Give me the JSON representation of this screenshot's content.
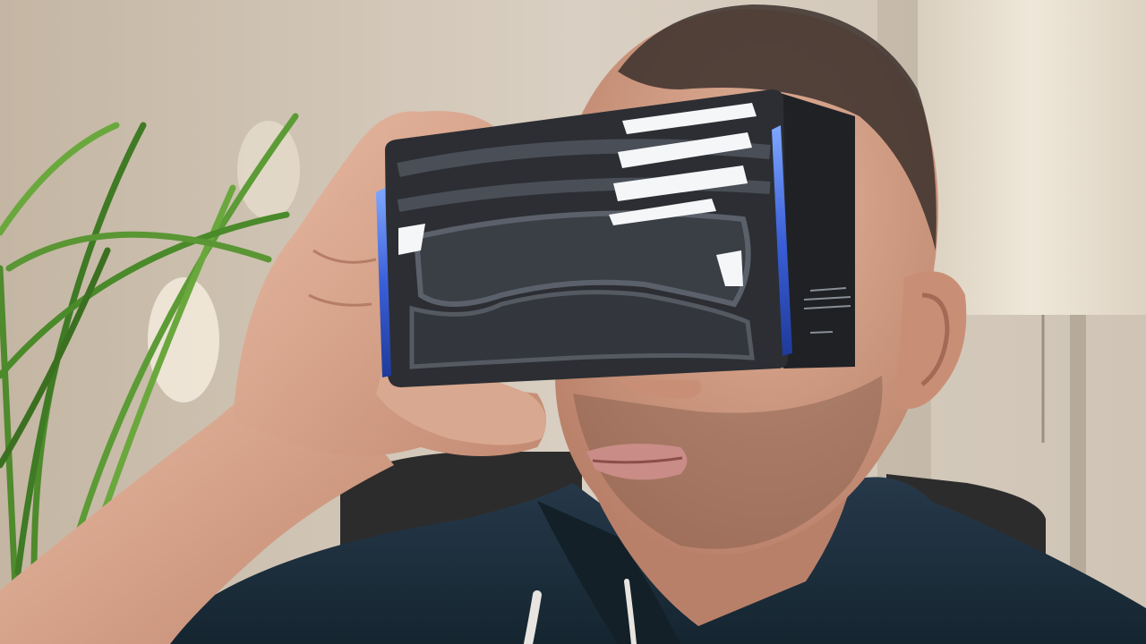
{
  "photo": {
    "colors": {
      "wall": "#d9cfc2",
      "wall_shadow": "#b9ab99",
      "lamp_shade": "#e8dfd0",
      "sofa": "#2d2c2c",
      "skin": "#d7a58b",
      "skin_shadow": "#b98069",
      "hair": "#3b302b",
      "hoodie": "#1e2f38",
      "headset": "#2c2e33",
      "headset_print": "#555a62",
      "headset_highlight": "#f4f6f8",
      "phone_edge": "#3a5fd8",
      "plant": "#4f8a2d",
      "lips": "#c98c86"
    }
  }
}
